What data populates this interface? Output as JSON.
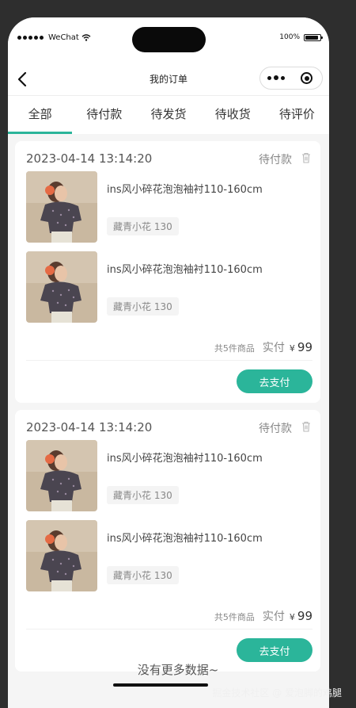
{
  "status_bar": {
    "carrier": "WeChat",
    "battery": "100%"
  },
  "nav": {
    "title": "我的订单"
  },
  "tabs": [
    {
      "label": "全部",
      "active": true
    },
    {
      "label": "待付款",
      "active": false
    },
    {
      "label": "待发货",
      "active": false
    },
    {
      "label": "待收货",
      "active": false
    },
    {
      "label": "待评价",
      "active": false
    }
  ],
  "orders": [
    {
      "date": "2023-04-14 13:14:20",
      "status": "待付款",
      "items": [
        {
          "name": "ins风小碎花泡泡袖衬110-160cm",
          "sku": "藏青小花 130"
        },
        {
          "name": "ins风小碎花泡泡袖衬110-160cm",
          "sku": "藏青小花 130"
        }
      ],
      "count_text": "共5件商品",
      "paid_label": "实付",
      "currency": "¥",
      "amount": "99",
      "pay_label": "去支付"
    },
    {
      "date": "2023-04-14 13:14:20",
      "status": "待付款",
      "items": [
        {
          "name": "ins风小碎花泡泡袖衬110-160cm",
          "sku": "藏青小花 130"
        },
        {
          "name": "ins风小碎花泡泡袖衬110-160cm",
          "sku": "藏青小花 130"
        }
      ],
      "count_text": "共5件商品",
      "paid_label": "实付",
      "currency": "¥",
      "amount": "99",
      "pay_label": "去支付"
    }
  ],
  "footer": {
    "no_more": "没有更多数据~",
    "watermark": "掘金技术社区 @ 爱泡脚的鸡腿"
  },
  "colors": {
    "accent": "#2bb59a",
    "page_bg": "#f5f5f5",
    "outer_bg": "#2e2e2e"
  }
}
